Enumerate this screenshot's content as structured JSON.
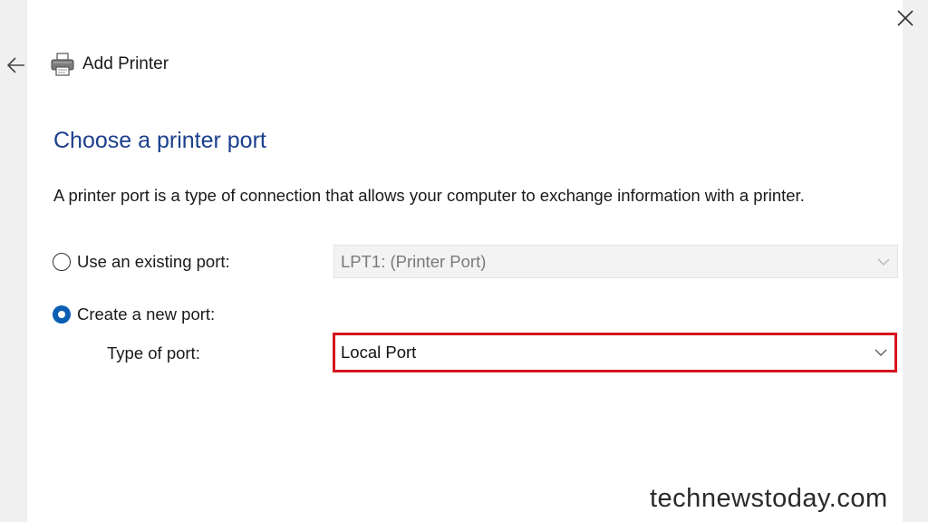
{
  "window": {
    "title": "Add Printer",
    "close_icon": "close-icon",
    "back_icon": "back-arrow-icon",
    "printer_icon": "printer-icon"
  },
  "page": {
    "heading": "Choose a printer port",
    "description": "A printer port is a type of connection that allows your computer to exchange information with a printer."
  },
  "options": {
    "existing": {
      "label": "Use an existing port:",
      "selected": false,
      "value": "LPT1: (Printer Port)",
      "disabled": true
    },
    "create": {
      "label": "Create a new port:",
      "selected": true,
      "type_label": "Type of port:",
      "value": "Local Port"
    }
  },
  "colors": {
    "heading": "#1b3f8c",
    "radio_accent": "#0a5fb4",
    "highlight_border": "#d7141e"
  },
  "watermark": "technewstoday.com"
}
